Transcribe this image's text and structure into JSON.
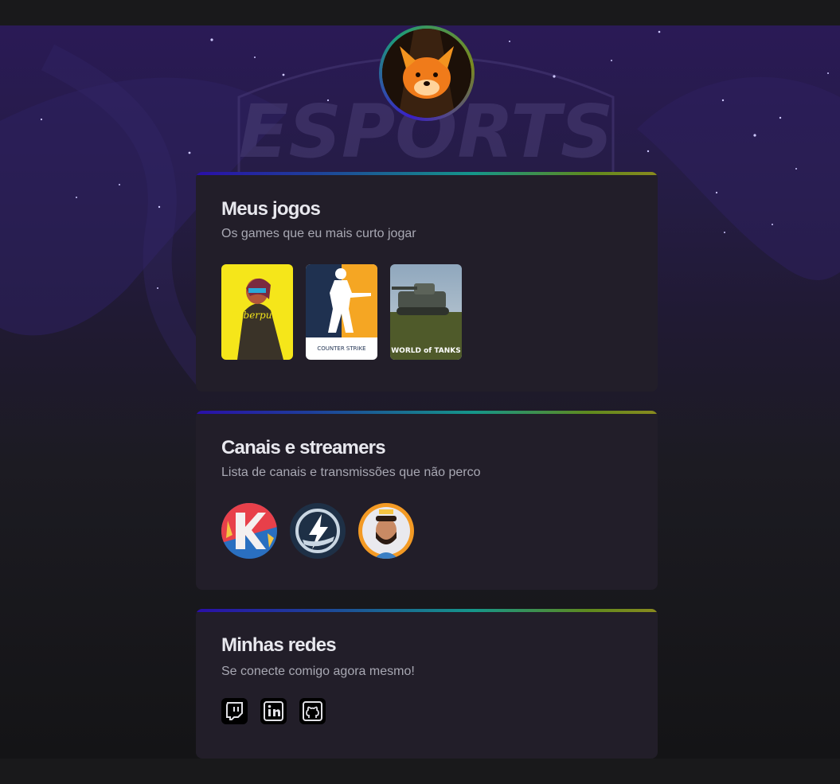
{
  "hero": {
    "logo_text": "ESPORTS"
  },
  "games_section": {
    "title": "Meus jogos",
    "subtitle": "Os games que eu mais curto jogar",
    "games": [
      {
        "icon": "cyberpunk-cover-icon",
        "cover_text": "Cyberpunk"
      },
      {
        "icon": "counter-strike-cover-icon",
        "cover_text": "COUNTER STRIKE"
      },
      {
        "icon": "world-of-tanks-cover-icon",
        "cover_text": "WORLD of TANKS"
      }
    ]
  },
  "streamers_section": {
    "title": "Canais e streamers",
    "subtitle": "Lista de canais e transmissões que não perco",
    "streamers": [
      {
        "icon": "streamer-k-logo-icon"
      },
      {
        "icon": "streamer-lightning-logo-icon"
      },
      {
        "icon": "streamer-avatar-icon"
      }
    ]
  },
  "socials_section": {
    "title": "Minhas redes",
    "subtitle": "Se conecte comigo agora mesmo!",
    "links": [
      {
        "icon": "twitch-icon"
      },
      {
        "icon": "linkedin-icon"
      },
      {
        "icon": "github-icon"
      }
    ]
  }
}
